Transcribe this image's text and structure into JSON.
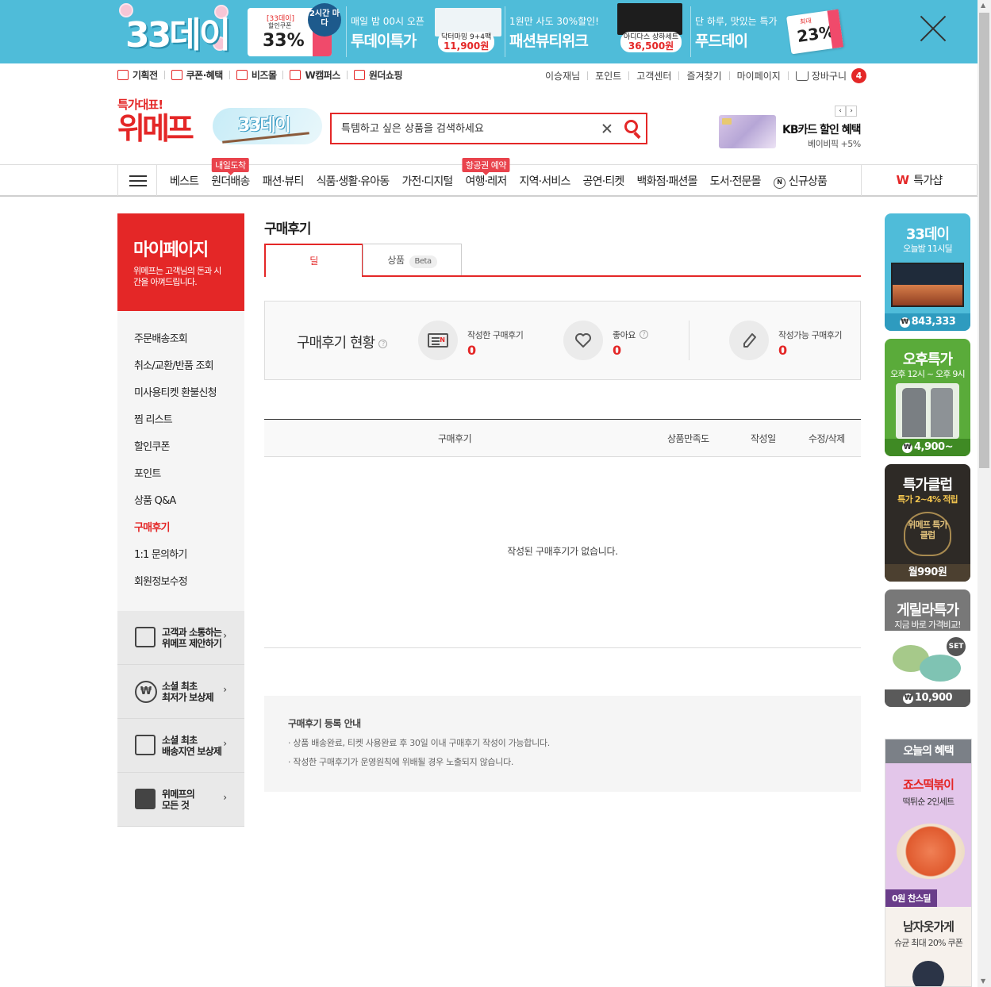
{
  "promo": {
    "logo": "33데이",
    "coupon_tag": "[33데이]",
    "coupon_sub": "할인쿠폰",
    "coupon_pct": "33%",
    "badge": "2시간 마다",
    "blocks": [
      {
        "line1": "매일 밤 00시 오픈",
        "line2": "투데이특가",
        "product": "닥터마밍 9+4팩",
        "price": "11,900원"
      },
      {
        "line1": "1원만 사도 30%할인!",
        "line2": "패션뷰티위크",
        "product": "아디다스 상하세트",
        "price": "36,500원"
      },
      {
        "line1": "단 하루, 맛있는 특가",
        "line2": "푸드데이"
      }
    ],
    "coupon_max": "최대",
    "coupon_pct2": "23%",
    "coupon_word": "coupon"
  },
  "util": {
    "left": [
      "기획전",
      "쿠폰·혜택",
      "비즈몰",
      "W캠퍼스",
      "원더쇼핑"
    ],
    "right": [
      "이승재님",
      "포인트",
      "고객센터",
      "즐겨찾기",
      "마이페이지"
    ],
    "cart_label": "장바구니",
    "cart_count": "4"
  },
  "header": {
    "brand_sub": "특가대표!",
    "brand_main": "위메프",
    "event_logo": "33데이",
    "search_placeholder": "특템하고 싶은 상품을 검색하세요",
    "ad_title": "KB카드 할인 혜택",
    "ad_sub": "베이비픽 +5%"
  },
  "gnb": {
    "items": [
      {
        "label": "베스트",
        "flag": ""
      },
      {
        "label": "원더배송",
        "flag": "내일도착"
      },
      {
        "label": "패션·뷰티",
        "flag": ""
      },
      {
        "label": "식품·생활·유아동",
        "flag": ""
      },
      {
        "label": "가전·디지털",
        "flag": ""
      },
      {
        "label": "여행·레저",
        "flag": "항공권 예약"
      },
      {
        "label": "지역·서비스",
        "flag": ""
      },
      {
        "label": "공연·티켓",
        "flag": ""
      },
      {
        "label": "백화점·패션몰",
        "flag": ""
      },
      {
        "label": "도서·전문몰",
        "flag": ""
      },
      {
        "label": "신규상품",
        "flag": ""
      }
    ],
    "new_icon": "N",
    "right_icon": "W",
    "right_label": "특가샵"
  },
  "sidebar": {
    "title": "마이페이지",
    "desc": "위메프는 고객님의 돈과 시간을 아껴드립니다.",
    "menu": [
      {
        "label": "주문배송조회",
        "active": false
      },
      {
        "label": "취소/교환/반품 조회",
        "active": false
      },
      {
        "label": "미사용티켓 환불신청",
        "active": false
      },
      {
        "label": "찜 리스트",
        "active": false
      },
      {
        "label": "할인쿠폰",
        "active": false
      },
      {
        "label": "포인트",
        "active": false
      },
      {
        "label": "상품 Q&A",
        "active": false
      },
      {
        "label": "구매후기",
        "active": true
      },
      {
        "label": "1:1 문의하기",
        "active": false
      },
      {
        "label": "회원정보수정",
        "active": false
      }
    ],
    "extras": [
      {
        "line1": "고객과 소통하는",
        "line2": "위메프 제안하기"
      },
      {
        "line1": "소셜 최초",
        "line2": "최저가 보상제"
      },
      {
        "line1": "소셜 최초",
        "line2": "배송지연 보상제"
      },
      {
        "line1": "위메프의",
        "line2": "모든 것"
      }
    ]
  },
  "main": {
    "title": "구매후기",
    "tabs": [
      {
        "label": "딜",
        "active": true
      },
      {
        "label": "상품",
        "badge": "Beta",
        "active": false
      }
    ],
    "status": {
      "title": "구매후기 현황",
      "written_label": "작성한 구매후기",
      "written_value": "0",
      "likes_label": "좋아요",
      "likes_value": "0",
      "writable_label": "작성가능 구매후기",
      "writable_value": "0"
    },
    "table": {
      "columns": [
        "구매후기",
        "상품만족도",
        "작성일",
        "수정/삭제"
      ],
      "empty": "작성된 구매후기가 없습니다."
    },
    "guide": {
      "title": "구매후기 등록 안내",
      "lines": [
        "· 상품 배송완료, 티켓 사용완료 후 30일 이내 구매후기 작성이 가능합니다.",
        "· 작성한 구매후기가 운영원칙에 위배될 경우 노출되지 않습니다."
      ]
    }
  },
  "wing": {
    "banners": [
      {
        "title": "33데이",
        "sub": "오늘밤 11시딜",
        "price": "843,333",
        "color": "#4fbcd9"
      },
      {
        "title": "오후특가",
        "sub": "오후 12시 ~ 오후 9시",
        "price": "4,900~",
        "color": "#5aab3a"
      },
      {
        "title": "특가클럽",
        "sub": "특가 2~4% 적립",
        "price": "월990원",
        "color": "#2e2a26",
        "emblem": "위메프 특가클럽"
      },
      {
        "title": "게릴라특가",
        "sub": "지금 바로 가격비교!",
        "price": "10,900",
        "color": "#787878",
        "tag": "SET"
      }
    ],
    "benefit_title": "오늘의 혜택",
    "benefit1": {
      "title": "죠스떡볶이",
      "sub": "떡튀순 2인세트",
      "tag": "0원 찬스딜"
    },
    "benefit2": {
      "title": "남자옷가게",
      "sub": "슈균 최대 20% 쿠폰"
    }
  }
}
